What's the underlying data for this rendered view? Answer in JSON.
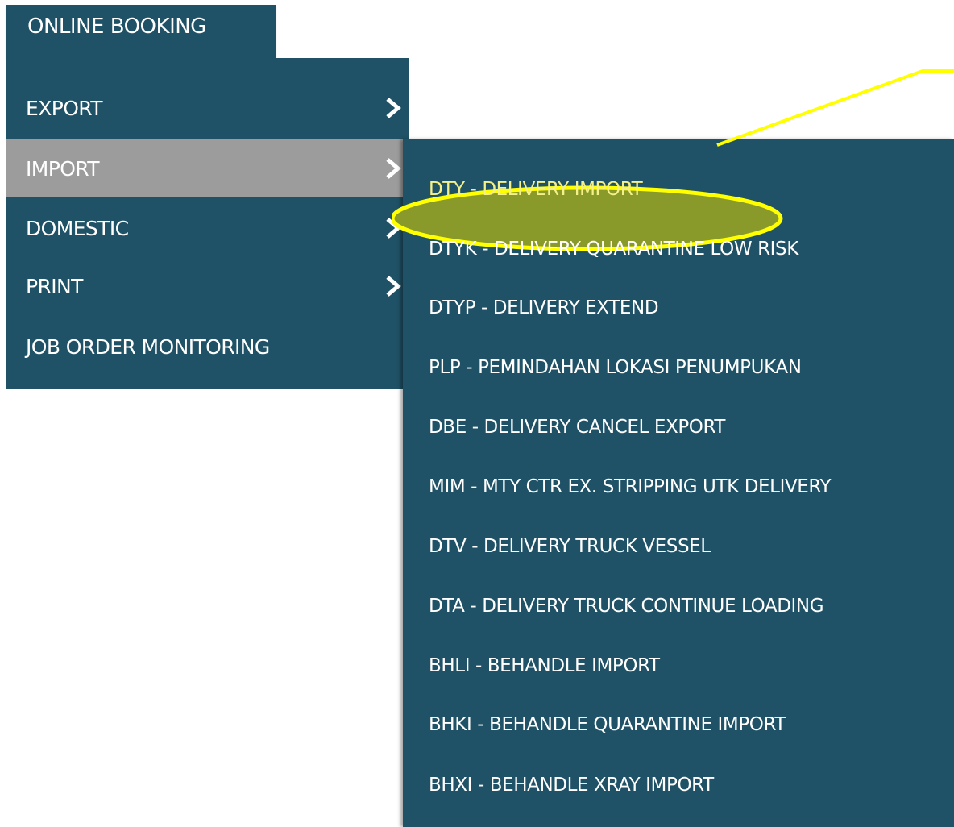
{
  "top_tab": {
    "label": "ONLINE BOOKING"
  },
  "menu": {
    "items": [
      {
        "label": "EXPORT",
        "has_submenu": true
      },
      {
        "label": "IMPORT",
        "has_submenu": true,
        "active": true
      },
      {
        "label": "DOMESTIC",
        "has_submenu": true
      },
      {
        "label": "PRINT",
        "has_submenu": true
      },
      {
        "label": "JOB ORDER MONITORING",
        "has_submenu": false
      }
    ]
  },
  "submenu": {
    "items": [
      {
        "label": "DTY - DELIVERY IMPORT",
        "highlighted": true
      },
      {
        "label": "DTYK - DELIVERY QUARANTINE LOW RISK"
      },
      {
        "label": "DTYP - DELIVERY EXTEND"
      },
      {
        "label": "PLP - PEMINDAHAN LOKASI PENUMPUKAN"
      },
      {
        "label": "DBE - DELIVERY CANCEL EXPORT"
      },
      {
        "label": "MIM - MTY CTR EX. STRIPPING UTK DELIVERY"
      },
      {
        "label": "DTV - DELIVERY TRUCK VESSEL"
      },
      {
        "label": "DTA - DELIVERY TRUCK CONTINUE LOADING"
      },
      {
        "label": "BHLI - BEHANDLE IMPORT"
      },
      {
        "label": "BHKI - BEHANDLE QUARANTINE IMPORT"
      },
      {
        "label": "BHXI - BEHANDLE XRAY IMPORT"
      }
    ]
  },
  "colors": {
    "menu_bg": "#1f5266",
    "active_bg": "#9c9c9c",
    "highlight_ellipse": "#8a9a2a",
    "highlight_outline": "#ffff00",
    "highlight_text": "#f4f08a"
  },
  "icons": {
    "submenu_indicator": "chevron-right-icon"
  }
}
